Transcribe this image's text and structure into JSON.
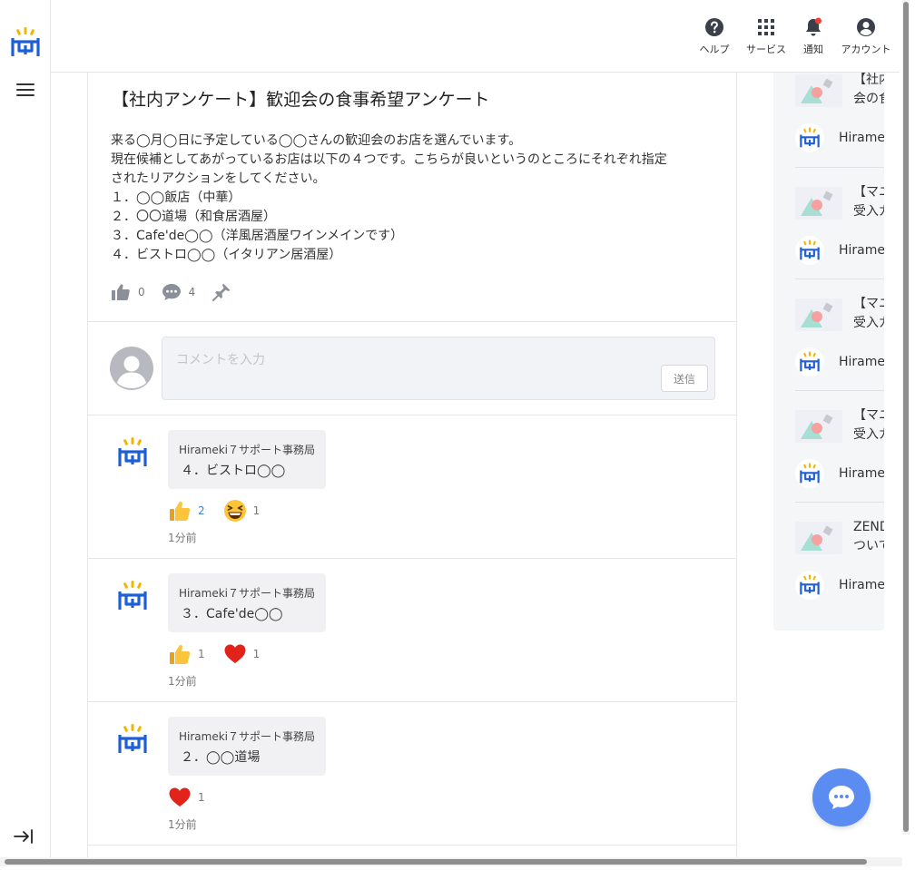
{
  "header": {
    "help": "ヘルプ",
    "services": "サービス",
    "notifications": "通知",
    "account": "アカウント"
  },
  "colors": {
    "logo_blue": "#1f5fd6",
    "logo_gold": "#f4b400",
    "accent": "#5b8cf2",
    "notify_dot": "#e8413b"
  },
  "post": {
    "title": "【社内アンケート】歓迎会の食事希望アンケート",
    "body_lines": [
      "来る◯月◯日に予定している◯◯さんの歓迎会のお店を選んでいます。",
      "現在候補としてあがっているお店は以下の４つです。こちらが良いというのところにそれぞれ指定",
      "されたリアクションをしてください。",
      "１．◯◯飯店（中華）",
      "２．〇〇道場（和食居酒屋）",
      "３．Cafe'de◯◯（洋風居酒屋ワインメインです）",
      "４．ビストロ◯◯（イタリアン居酒屋）"
    ],
    "like_count": "0",
    "comment_count": "4"
  },
  "comment_input": {
    "placeholder": "コメントを入力",
    "send_label": "送信"
  },
  "replies": [
    {
      "author": "Hirameki７サポート事務局",
      "text": "４．ビストロ◯◯",
      "reactions": [
        {
          "emoji": "thumbs-up",
          "count": "2",
          "highlight": true
        },
        {
          "emoji": "grinning-squint",
          "count": "1",
          "highlight": false
        }
      ],
      "time": "1分前"
    },
    {
      "author": "Hirameki７サポート事務局",
      "text": "３．Cafe'de◯◯",
      "reactions": [
        {
          "emoji": "thumbs-up",
          "count": "1",
          "highlight": false
        },
        {
          "emoji": "red-heart",
          "count": "1",
          "highlight": false
        }
      ],
      "time": "1分前"
    },
    {
      "author": "Hirameki７サポート事務局",
      "text": "２．◯◯道場",
      "reactions": [
        {
          "emoji": "red-heart",
          "count": "1",
          "highlight": false
        }
      ],
      "time": "1分前"
    }
  ],
  "sidebar": {
    "items": [
      {
        "title1": "【社内",
        "title2": "会の食",
        "author": "Hirameki"
      },
      {
        "title1": "【マニ",
        "title2": "受入ガ",
        "author": "Hirameki"
      },
      {
        "title1": "【マニ",
        "title2": "受入ガ",
        "author": "Hirameki"
      },
      {
        "title1": "【マニ",
        "title2": "受入ガ",
        "author": "Hirameki"
      },
      {
        "title1": "ZEND",
        "title2": "ついて",
        "author": "Hirameki"
      }
    ]
  }
}
